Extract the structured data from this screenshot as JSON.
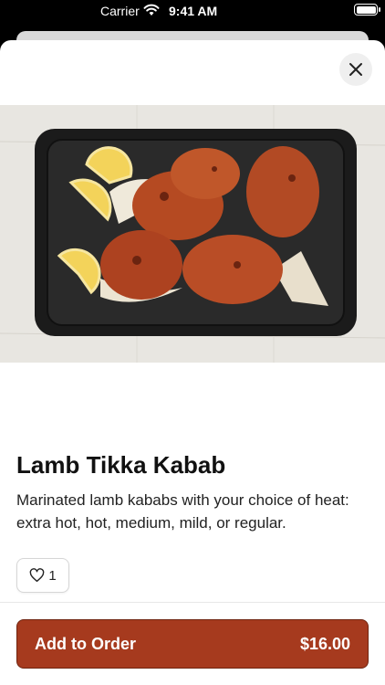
{
  "status_bar": {
    "carrier": "Carrier",
    "time": "9:41 AM",
    "wifi_icon": "wifi-icon",
    "battery_icon": "battery-icon"
  },
  "item": {
    "title": "Lamb Tikka Kabab",
    "description": "Marinated lamb kababs with your choice of heat: extra hot, hot, medium, mild, or regular.",
    "image_icon": "food-photo",
    "like_count": "1"
  },
  "actions": {
    "close_icon": "close-icon",
    "like_icon": "heart-icon",
    "add_label": "Add to Order",
    "price": "$16.00"
  },
  "colors": {
    "accent": "#a63a1e",
    "accent_border": "#6f2410"
  }
}
